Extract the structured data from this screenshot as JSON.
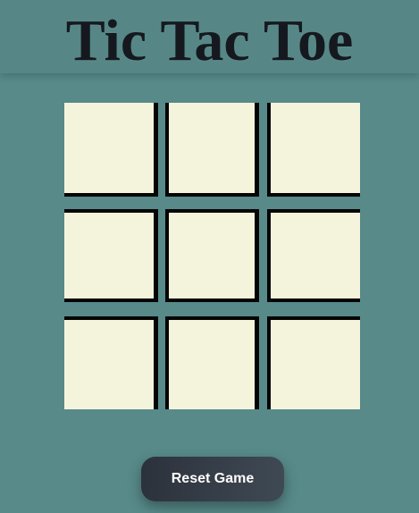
{
  "header": {
    "title": "Tic Tac Toe"
  },
  "board": {
    "cells": [
      "",
      "",
      "",
      "",
      "",
      "",
      "",
      "",
      ""
    ]
  },
  "controls": {
    "reset_label": "Reset Game"
  },
  "colors": {
    "background": "#578a89",
    "cell": "#f4f4dd",
    "grid_line": "#050505",
    "button": "#2c323c",
    "title": "#15191f"
  }
}
